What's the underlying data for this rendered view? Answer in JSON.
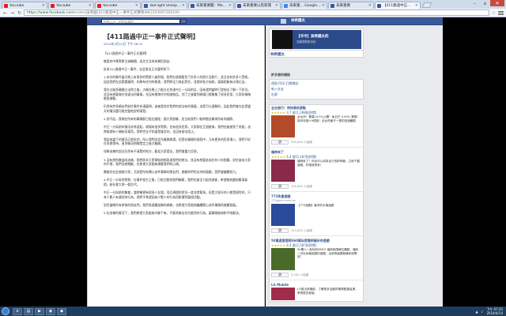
{
  "browser": {
    "tabs": [
      {
        "title": "YouTube",
        "color": "#e02020",
        "active": false
      },
      {
        "title": "YouTube",
        "color": "#e02020",
        "active": false
      },
      {
        "title": "YouTube",
        "color": "#e02020",
        "active": false
      },
      {
        "title": "TwiFlight Shoop - Li",
        "color": "#3b5998",
        "active": false
      },
      {
        "title": "未來重要聞：Mobile",
        "color": "#3b5998",
        "active": false
      },
      {
        "title": "未來重要以及新開",
        "color": "#3b5998",
        "active": false
      },
      {
        "title": "未來重... Google 新",
        "color": "#4285f4",
        "active": false
      },
      {
        "title": "未來重要",
        "color": "#3b5998",
        "active": false
      },
      {
        "title": "【411路過中正一事",
        "color": "#3b5998",
        "active": true
      }
    ],
    "url_host": "https://www.facebook.com",
    "url_path": "/notes/吳希國/411路過中正一事件正式聲明/861503087200290"
  },
  "facebook": {
    "search_placeholder": "搜尋人名、地點和事物",
    "user_name": "林希國太"
  },
  "note": {
    "title": "【411路過中正一事件正式聲明】",
    "date": "2014年4月10日 下午 06:32",
    "paragraphs": [
      "【411路過中正一事件正式聲明】",
      "敬愛的中華警察主辦機關，吳先生及所有鄉民朋友：",
      "針對411路過中正一事件，在此發出正式聲明如下：",
      "1.本次的事件當天晚上有眾多的警察人員到場，我們在現場看到了許多人的照片及影片，並且也有許多人受傷，因此我們在此鄭重聲明，如果有任何的傷害，我們將全力負起責任，並請求各方協助，讓真相能夠水落石出。",
      "我在五點多離開立法院之後，大概在晚上六點左右到達中正一分局附近，因為我們當時只是想去了解一下狀況，並沒有想要做任何違法的事情，也沒有攜帶任何危險物品。到了之後看到現場已經聚集了很多民眾，大家的情緒都很激動。",
      "仍然有許多網友們對於事件充滿疑問，或者是對於我們的說法有所質疑，這是可以理解的，因此我們會在此把當天的情況盡可能完整地說明清楚。",
      "2.對不起，我現在所有的事情都已經在處理，請大家諒解，並且給我們一點時間去釐清所有的細節。",
      "中正一分局前的情況非常混亂，現場有很多警察，也有很多民眾，大家都在互相推擠，我們也被推到了前面，這時候就有人開始丟東西，我們完全不知道是誰丟的，也沒有辦法阻止。",
      "我認為當下的情況已經失控，所以我們決定先離開現場，但是在離開的過程中，又有更多的民眾湧入，我們只好在旁邊等待，直到情況稍微穩定之後才離開。",
      "如果這樣的說法仍然有不清楚的地方，歡迎大家提出，我們會盡力回答。",
      "3.沒有想到會變成這樣，我們原本只是單純地想表達我們的想法，並沒有想要造成任何人的困擾，對於造成大家的不便，我們深感抱歉，也希望大家能夠理解我們的心情。",
      "最後也在此感謝大家，尤其是所有關心這件事情的朋友們，謝謝你們的支持與鼓勵，我們會繼續努力。",
      "4.中正一分局的警察，在事件發生之後，已經主動與我們聯繫，我們也會全力配合調查，希望能夠盡快釐清真相，給社會大眾一個交代。",
      "中正一分局前的集會，當時確實有很多人在場，而且現場的狀況一度非常緊張，但是大部分的人都是理性的，只有少數人有激烈的行為，我們不希望因為少數人的行為而影響到整個活動。",
      "對於當晚所有參與的朋友們，我們表達最誠摯的感謝，也希望大家能夠繼續關心這件事情的後續發展。",
      "5.在這樣的情況下，我們希望大家能夠冷靜下來，不要再做出任何激烈的行為，讓事情能夠和平地解決。"
    ]
  },
  "sidebar": {
    "page_card": {
      "banner_line1": "【冷冷】吳希國太的",
      "banner_line2_prefix": "共創您的",
      "banner_line2_highlight": "新世紀",
      "name": "林希國太"
    },
    "links_box": {
      "link1": "透過 RSS 訂閱網誌",
      "link2": "新入社友",
      "link3": "社群"
    },
    "ad1": {
      "title": "全台旅行！特快車的景點",
      "stars": "★★★★★",
      "rating": "3.7 星(1,298則評價)",
      "text": "全台灣！驚喜19.9%公開！每日打 0.99% 驚喜！幫你特惠9.9優惠！全台灣最不一樣的旅遊體驗",
      "like_label": "讚",
      "likes": "500,000 人說讚"
    },
    "ad2": {
      "title": "福神來了",
      "stars": "★★★★★",
      "rating": "4.4 星(5,187則評價)",
      "text": "福神來了！你也可以成為自己的財神爺，立即下載遊戲，好運就會來！",
      "like_label": "讚",
      "likes": "100,000 人說讚"
    },
    "ad3": {
      "title": "773免費遊戲",
      "subtitle": "773game.com.tw",
      "text": "【773遊戲】最夯的手機遊戲",
      "like_label": "讚",
      "likes": "124,000 人說讚"
    },
    "ad4": {
      "title": "50萬遊客提問360萬玩家證明最好的遊戲",
      "stars": "★★★★★",
      "rating": "4.4 星(2,587則評價)",
      "text": "50萬人一起玩的MMO! 最新無限轉生體驗，讓你一次玩到最過癮的遊戲，全新等級跟裝備系統開放！",
      "like_label": "讚",
      "likes": "5,000 人說讚"
    },
    "ad5": {
      "title": "LG Mobile",
      "text": "LG推出新機款，了解更多活動詳情請點選這裡，享受更多優惠。",
      "like_label": "讚",
      "likes": ""
    },
    "also_label": "許多感的網誌"
  },
  "taskbar": {
    "time": "下午 07:25",
    "date": "2014/4/14"
  }
}
